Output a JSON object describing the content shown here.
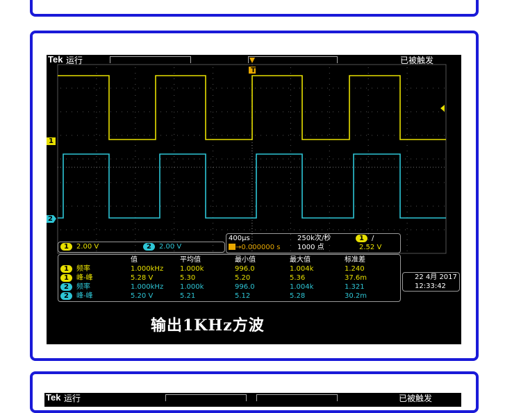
{
  "scope": {
    "brand": "Tek",
    "run_state": "运行",
    "trigger_state": "已被触发",
    "trigger_marker": "T",
    "ch1_marker": "1",
    "ch2_marker": "2",
    "ch1_scale": "2.00 V",
    "ch2_scale": "2.00 V",
    "ch1_badge": "1",
    "ch2_badge": "2",
    "timebase": "400μs",
    "sample_rate": "250k次/秒",
    "trigger_pos": "0.000000 s",
    "record_length": "1000 点",
    "trig_ch_badge": "1",
    "trig_slope": "/",
    "trig_level": "2.52 V",
    "date": "22 4月 2017",
    "time": "12:33:42",
    "colors": {
      "ch1": "#e8e000",
      "ch2": "#2ec6d6",
      "accent_border": "#1a1ad8"
    }
  },
  "measurements": {
    "headers": [
      "值",
      "平均值",
      "最小值",
      "最大值",
      "标准差"
    ],
    "rows": [
      {
        "ch": "1",
        "name": "频率",
        "values": [
          "1.000kHz",
          "1.000k",
          "996.0",
          "1.004k",
          "1.240"
        ]
      },
      {
        "ch": "1",
        "name": "峰-峰",
        "values": [
          "5.28 V",
          "5.30",
          "5.20",
          "5.36",
          "37.6m"
        ]
      },
      {
        "ch": "2",
        "name": "频率",
        "values": [
          "1.000kHz",
          "1.000k",
          "996.0",
          "1.004k",
          "1.321"
        ]
      },
      {
        "ch": "2",
        "name": "峰-峰",
        "values": [
          "5.20 V",
          "5.21",
          "5.12",
          "5.28",
          "30.2m"
        ]
      }
    ]
  },
  "caption": "输出1KHz方波",
  "bottom_scope": {
    "brand": "Tek",
    "run_state": "运行",
    "trigger_state": "已被触发"
  }
}
